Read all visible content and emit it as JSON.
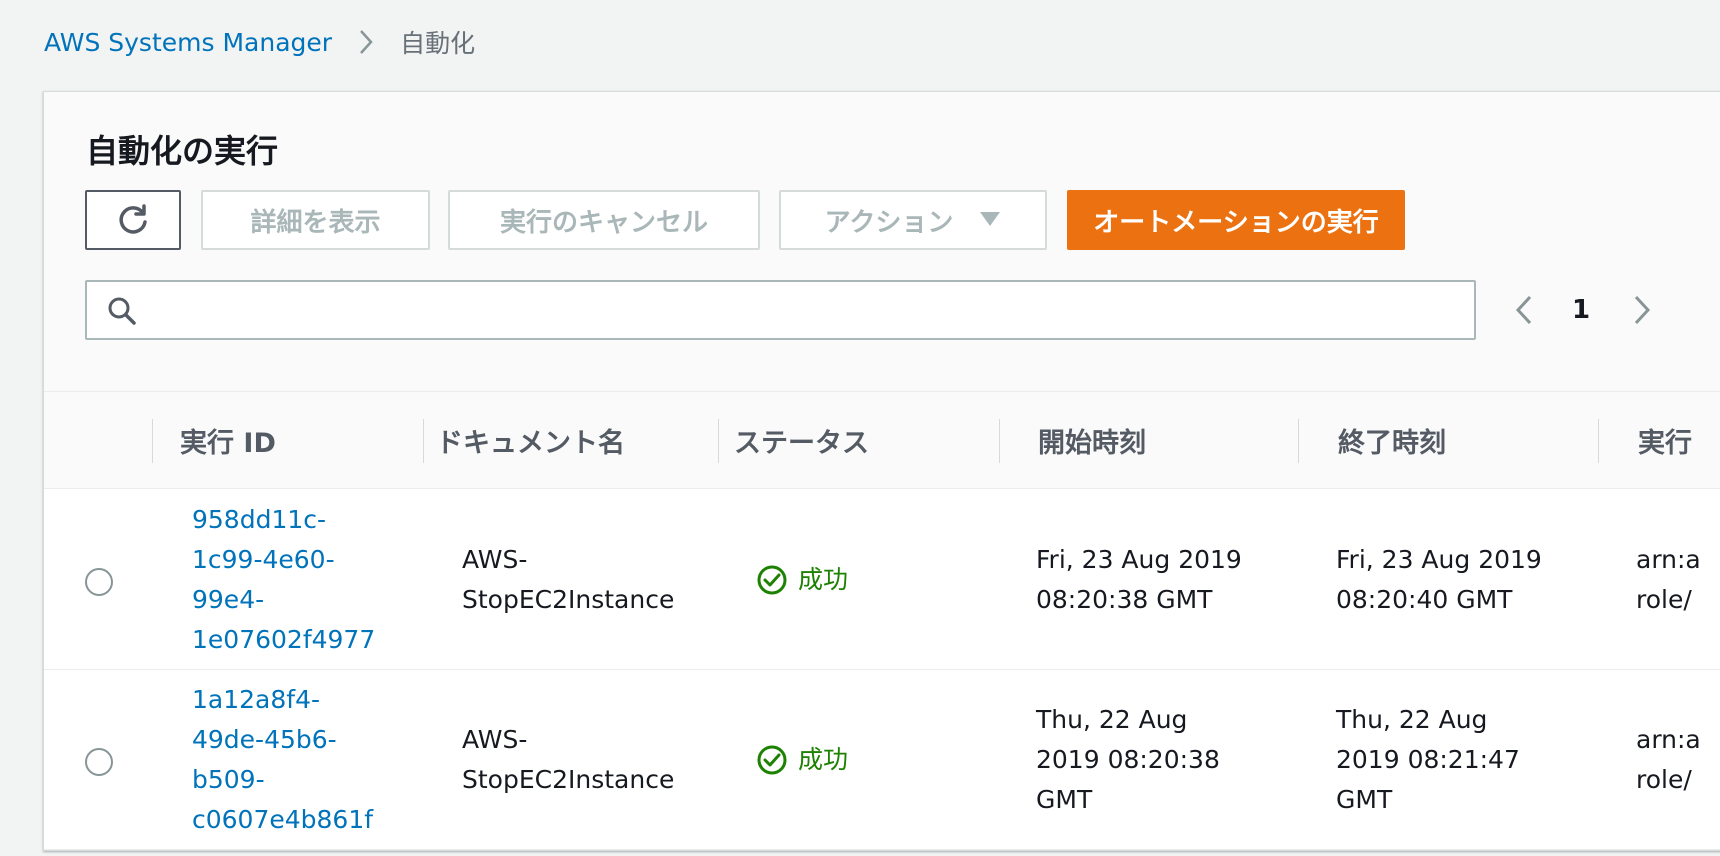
{
  "breadcrumb": {
    "root": "AWS Systems Manager",
    "current": "自動化"
  },
  "panel": {
    "title": "自動化の実行",
    "buttons": {
      "details": "詳細を表示",
      "cancel": "実行のキャンセル",
      "actions": "アクション",
      "run": "オートメーションの実行"
    },
    "search_placeholder": "",
    "page": "1"
  },
  "table": {
    "headers": [
      "実行 ID",
      "ドキュメント名",
      "ステータス",
      "開始時刻",
      "終了時刻",
      "実行"
    ],
    "rows": [
      {
        "id_lines": [
          "958dd11c-",
          "1c99-4e60-",
          "99e4-",
          "1e07602f4977"
        ],
        "doc_lines": [
          "AWS-",
          "StopEC2Instance"
        ],
        "status": "成功",
        "start_lines": [
          "Fri, 23 Aug 2019",
          "08:20:38 GMT"
        ],
        "end_lines": [
          "Fri, 23 Aug 2019",
          "08:20:40 GMT"
        ],
        "exec_lines": [
          "arn:a",
          "role/"
        ]
      },
      {
        "id_lines": [
          "1a12a8f4-",
          "49de-45b6-",
          "b509-",
          "c0607e4b861f"
        ],
        "doc_lines": [
          "AWS-",
          "StopEC2Instance"
        ],
        "status": "成功",
        "start_lines": [
          "Thu, 22 Aug",
          "2019 08:20:38",
          "GMT"
        ],
        "end_lines": [
          "Thu, 22 Aug",
          "2019 08:21:47",
          "GMT"
        ],
        "exec_lines": [
          "arn:a",
          "role/"
        ]
      }
    ]
  },
  "colors": {
    "link": "#0073bb",
    "primary": "#ec7211",
    "success": "#1d8102"
  },
  "icons": [
    "chevron-right-icon",
    "refresh-icon",
    "caret-down-icon",
    "search-icon",
    "chevron-left-icon",
    "success-check-icon"
  ]
}
